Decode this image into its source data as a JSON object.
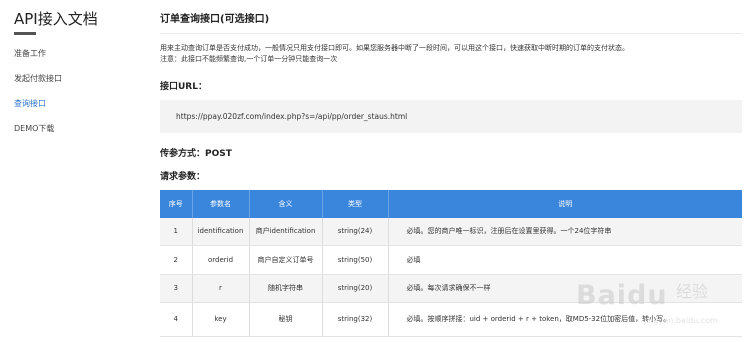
{
  "sidebar": {
    "title": "API接入文档",
    "items": [
      {
        "label": "准备工作",
        "active": false
      },
      {
        "label": "发起付款接口",
        "active": false
      },
      {
        "label": "查询接口",
        "active": true
      },
      {
        "label": "DEMO下载",
        "active": false
      }
    ]
  },
  "main": {
    "title": "订单查询接口(可选接口)",
    "desc_line1": "用来主动查询订单是否支付成功，一般情况只用支付接口即可。如果您服务器中断了一段时间，可以用这个接口，快速获取中断时期的订单的支付状态。",
    "desc_line2": "注意：此接口不能频繁查询,一个订单一分钟只能查询一次",
    "url_heading": "接口URL：",
    "url": "https://ppay.020zf.com/index.php?s=/api/pp/order_staus.html",
    "method_heading": "传参方式：POST",
    "params_heading": "请求参数：",
    "table": {
      "headers": [
        "序号",
        "参数名",
        "含义",
        "类型",
        "说明"
      ],
      "rows": [
        {
          "no": "1",
          "name": "identification",
          "meaning": "商户identification",
          "type": "string(24)",
          "note": "必填。您的商户唯一标识，注册后在设置里获得。一个24位字符串"
        },
        {
          "no": "2",
          "name": "orderid",
          "meaning": "商户自定义订单号",
          "type": "string(50)",
          "note": "必填"
        },
        {
          "no": "3",
          "name": "r",
          "meaning": "随机字符串",
          "type": "string(20)",
          "note": "必填。每次请求确保不一样"
        },
        {
          "no": "4",
          "name": "key",
          "meaning": "秘钥",
          "type": "string(32)",
          "note": "必填。按顺序拼接：uid + orderid + r + token，取MD5-32位加密后值，转小写。"
        }
      ]
    }
  },
  "watermark": {
    "brand": "Baidu",
    "sub": "经验",
    "domain": "jingyan.baidu.com",
    "color": "#c9c9c9"
  },
  "colors": {
    "accent": "#3b86dd",
    "active_link": "#2b73c9"
  }
}
